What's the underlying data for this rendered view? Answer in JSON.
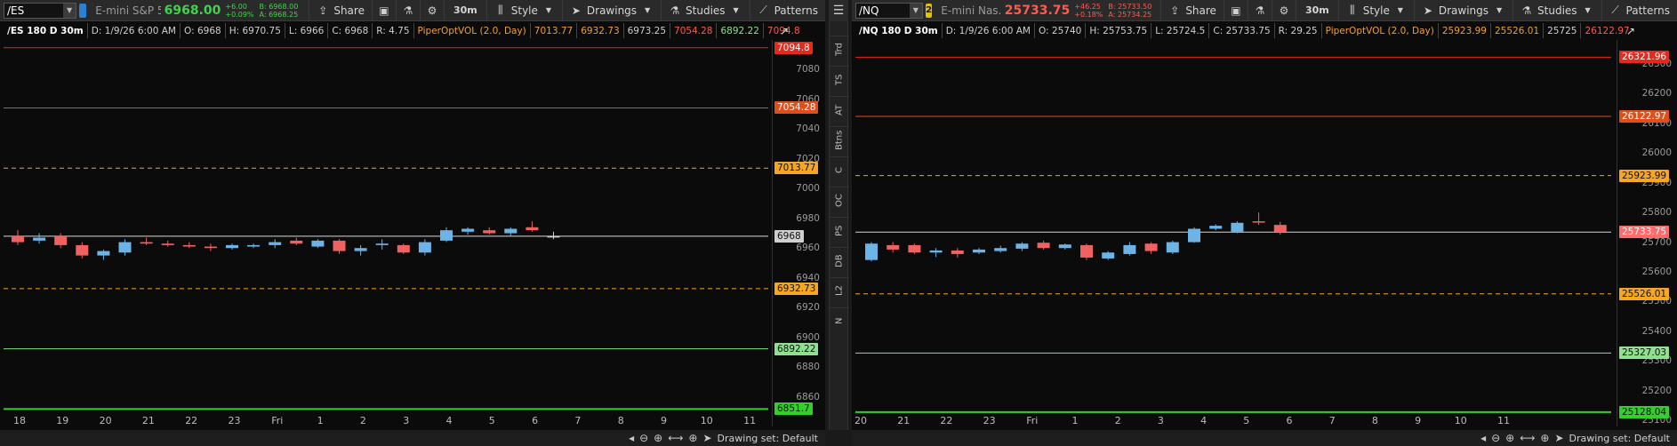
{
  "left": {
    "symbol": "/ES",
    "link_badge": "",
    "link_color": "#2a7fd6",
    "description": "E-mini S&P 5...",
    "last": "6968.00",
    "last_color": "#3fd34a",
    "change": "+6.00",
    "change_pct": "+0.09%",
    "bid": "B: 6968.00",
    "ask": "A: 6968.25",
    "bidask_color": "#3fd34a",
    "toolbar": {
      "share": "Share",
      "timeframe": "30m",
      "style": "Style",
      "drawings": "Drawings",
      "studies": "Studies",
      "patterns": "Patterns"
    },
    "info": {
      "title": "/ES 180 D 30m",
      "date": "D: 1/9/26 6:00 AM",
      "open": "O: 6968",
      "high": "H: 6970.75",
      "low": "L: 6966",
      "close": "C: 6968",
      "range": "R: 4.75",
      "study": "PiperOptVOL (2.0, Day)",
      "v1": "7013.77",
      "v2": "6932.73",
      "v3": "6973.25",
      "v4": "7054.28",
      "v5": "6892.22",
      "v6": "7094.8"
    },
    "axis_ticks": [
      "7080",
      "7060",
      "7040",
      "7020",
      "7000",
      "6980",
      "6960",
      "6940",
      "6920",
      "6900",
      "6880",
      "6860"
    ],
    "price_tags": [
      {
        "text": "7094.8",
        "bg": "#e32a1c",
        "fg": "#ffffff",
        "price": 7094.8
      },
      {
        "text": "7054.28",
        "bg": "#e04e1a",
        "fg": "#ffffff",
        "price": 7054.28
      },
      {
        "text": "7013.77",
        "bg": "#f5a623",
        "fg": "#111111",
        "price": 7013.77
      },
      {
        "text": "6968",
        "bg": "#cfcfcf",
        "fg": "#111111",
        "price": 6968
      },
      {
        "text": "6932.73",
        "bg": "#f5a623",
        "fg": "#111111",
        "price": 6932.73
      },
      {
        "text": "6892.22",
        "bg": "#8fe08f",
        "fg": "#111111",
        "price": 6892.22
      },
      {
        "text": "6851.7",
        "bg": "#32d12a",
        "fg": "#111111",
        "price": 6851.7
      }
    ],
    "x_labels": [
      "18",
      "19",
      "20",
      "21",
      "22",
      "23",
      "Fri",
      "1",
      "2",
      "3",
      "4",
      "5",
      "6",
      "7",
      "8",
      "9",
      "10",
      "11"
    ],
    "drawing_set": "Drawing set: Default"
  },
  "right": {
    "symbol": "/NQ",
    "link_badge": "2",
    "link_color": "#e3c000",
    "description": "E-mini Nas...",
    "last": "25733.75",
    "last_color": "#ff5a4a",
    "change": "+46.25",
    "change_pct": "+0.18%",
    "bid": "B: 25733.50",
    "ask": "A: 25734.25",
    "bidask_color": "#ff5a4a",
    "toolbar": {
      "share": "Share",
      "timeframe": "30m",
      "style": "Style",
      "drawings": "Drawings",
      "studies": "Studies",
      "patterns": "Patterns"
    },
    "info": {
      "title": "/NQ 180 D 30m",
      "date": "D: 1/9/26 6:00 AM",
      "open": "O: 25740",
      "high": "H: 25753.75",
      "low": "L: 25724.5",
      "close": "C: 25733.75",
      "range": "R: 29.25",
      "study": "PiperOptVOL (2.0, Day)",
      "v1": "25923.99",
      "v2": "25526.01",
      "v3": "25725",
      "v4": "26122.97"
    },
    "axis_ticks": [
      "26300",
      "26200",
      "26100",
      "26000",
      "25900",
      "25800",
      "25700",
      "25600",
      "25500",
      "25400",
      "25300",
      "25200",
      "25100"
    ],
    "price_tags": [
      {
        "text": "26321.96",
        "bg": "#e32a1c",
        "fg": "#ffffff",
        "price": 26321.96
      },
      {
        "text": "26122.97",
        "bg": "#e04e1a",
        "fg": "#ffffff",
        "price": 26122.97
      },
      {
        "text": "25923.99",
        "bg": "#f5a623",
        "fg": "#111111",
        "price": 25923.99
      },
      {
        "text": "25733.75",
        "bg": "#ff6b6b",
        "fg": "#ffffff",
        "price": 25733.75
      },
      {
        "text": "25526.01",
        "bg": "#f5a623",
        "fg": "#111111",
        "price": 25526.01
      },
      {
        "text": "25327.03",
        "bg": "#8fe08f",
        "fg": "#111111",
        "price": 25327.03
      },
      {
        "text": "25128.04",
        "bg": "#32d12a",
        "fg": "#111111",
        "price": 25128.04
      }
    ],
    "x_labels": [
      "20",
      "21",
      "22",
      "23",
      "Fri",
      "1",
      "2",
      "3",
      "4",
      "5",
      "6",
      "7",
      "8",
      "9",
      "10",
      "11"
    ],
    "drawing_set": "Drawing set: Default"
  },
  "side_tabs": [
    "Trd",
    "TS",
    "AT",
    "Btns",
    "C",
    "OC",
    "PS",
    "DB",
    "L2",
    "N"
  ],
  "chart_data": [
    {
      "type": "candlestick",
      "symbol": "/ES",
      "ylim": [
        6840,
        7100
      ],
      "levels": [
        7094.8,
        7054.28,
        7013.77,
        6932.73,
        6892.22,
        6851.7
      ],
      "last": 6968,
      "candles": [
        {
          "o": 6968,
          "h": 6972,
          "l": 6962,
          "c": 6964,
          "up": false
        },
        {
          "o": 6965,
          "h": 6970,
          "l": 6963,
          "c": 6967,
          "up": true
        },
        {
          "o": 6968,
          "h": 6970,
          "l": 6960,
          "c": 6962,
          "up": false
        },
        {
          "o": 6962,
          "h": 6964,
          "l": 6953,
          "c": 6955,
          "up": false
        },
        {
          "o": 6955,
          "h": 6959,
          "l": 6952,
          "c": 6958,
          "up": true
        },
        {
          "o": 6957,
          "h": 6966,
          "l": 6955,
          "c": 6964,
          "up": true
        },
        {
          "o": 6964,
          "h": 6967,
          "l": 6962,
          "c": 6963,
          "up": false
        },
        {
          "o": 6963,
          "h": 6965,
          "l": 6961,
          "c": 6962,
          "up": false
        },
        {
          "o": 6962,
          "h": 6964,
          "l": 6960,
          "c": 6961,
          "up": false
        },
        {
          "o": 6961,
          "h": 6963,
          "l": 6958,
          "c": 6960,
          "up": false
        },
        {
          "o": 6960,
          "h": 6963,
          "l": 6959,
          "c": 6962,
          "up": true
        },
        {
          "o": 6961,
          "h": 6963,
          "l": 6960,
          "c": 6962,
          "up": true
        },
        {
          "o": 6962,
          "h": 6966,
          "l": 6960,
          "c": 6964,
          "up": true
        },
        {
          "o": 6965,
          "h": 6967,
          "l": 6962,
          "c": 6963,
          "up": false
        },
        {
          "o": 6961,
          "h": 6966,
          "l": 6960,
          "c": 6965,
          "up": true
        },
        {
          "o": 6965,
          "h": 6966,
          "l": 6956,
          "c": 6958,
          "up": false
        },
        {
          "o": 6958,
          "h": 6962,
          "l": 6955,
          "c": 6960,
          "up": true
        },
        {
          "o": 6962,
          "h": 6966,
          "l": 6959,
          "c": 6963,
          "up": true
        },
        {
          "o": 6962,
          "h": 6963,
          "l": 6956,
          "c": 6957,
          "up": false
        },
        {
          "o": 6957,
          "h": 6966,
          "l": 6955,
          "c": 6964,
          "up": true
        },
        {
          "o": 6965,
          "h": 6974,
          "l": 6964,
          "c": 6972,
          "up": true
        },
        {
          "o": 6971,
          "h": 6974,
          "l": 6969,
          "c": 6973,
          "up": true
        },
        {
          "o": 6972,
          "h": 6974,
          "l": 6969,
          "c": 6970,
          "up": false
        },
        {
          "o": 6970,
          "h": 6974,
          "l": 6968,
          "c": 6973,
          "up": true
        },
        {
          "o": 6974,
          "h": 6978,
          "l": 6971,
          "c": 6972,
          "up": false
        },
        {
          "o": 6968,
          "h": 6971,
          "l": 6966,
          "c": 6968,
          "up": null
        }
      ]
    },
    {
      "type": "candlestick",
      "symbol": "/NQ",
      "ylim": [
        25080,
        26380
      ],
      "levels": [
        26321.96,
        26122.97,
        25923.99,
        25526.01,
        25327.03,
        25128.04
      ],
      "last": 25733.75,
      "candles": [
        {
          "o": 25640,
          "h": 25700,
          "l": 25635,
          "c": 25695,
          "up": true
        },
        {
          "o": 25690,
          "h": 25700,
          "l": 25665,
          "c": 25675,
          "up": false
        },
        {
          "o": 25690,
          "h": 25695,
          "l": 25660,
          "c": 25665,
          "up": false
        },
        {
          "o": 25665,
          "h": 25680,
          "l": 25650,
          "c": 25672,
          "up": true
        },
        {
          "o": 25672,
          "h": 25680,
          "l": 25648,
          "c": 25660,
          "up": false
        },
        {
          "o": 25665,
          "h": 25680,
          "l": 25660,
          "c": 25675,
          "up": true
        },
        {
          "o": 25670,
          "h": 25688,
          "l": 25665,
          "c": 25680,
          "up": true
        },
        {
          "o": 25678,
          "h": 25700,
          "l": 25670,
          "c": 25695,
          "up": true
        },
        {
          "o": 25698,
          "h": 25705,
          "l": 25675,
          "c": 25680,
          "up": false
        },
        {
          "o": 25680,
          "h": 25695,
          "l": 25675,
          "c": 25692,
          "up": true
        },
        {
          "o": 25690,
          "h": 25695,
          "l": 25640,
          "c": 25648,
          "up": false
        },
        {
          "o": 25645,
          "h": 25670,
          "l": 25640,
          "c": 25665,
          "up": true
        },
        {
          "o": 25660,
          "h": 25700,
          "l": 25655,
          "c": 25690,
          "up": true
        },
        {
          "o": 25695,
          "h": 25700,
          "l": 25660,
          "c": 25670,
          "up": false
        },
        {
          "o": 25665,
          "h": 25705,
          "l": 25660,
          "c": 25700,
          "up": true
        },
        {
          "o": 25700,
          "h": 25750,
          "l": 25698,
          "c": 25745,
          "up": true
        },
        {
          "o": 25745,
          "h": 25760,
          "l": 25740,
          "c": 25755,
          "up": true
        },
        {
          "o": 25735,
          "h": 25770,
          "l": 25730,
          "c": 25765,
          "up": true
        },
        {
          "o": 25768,
          "h": 25800,
          "l": 25758,
          "c": 25770,
          "up": false
        },
        {
          "o": 25758,
          "h": 25768,
          "l": 25725,
          "c": 25734,
          "up": false
        }
      ]
    }
  ]
}
